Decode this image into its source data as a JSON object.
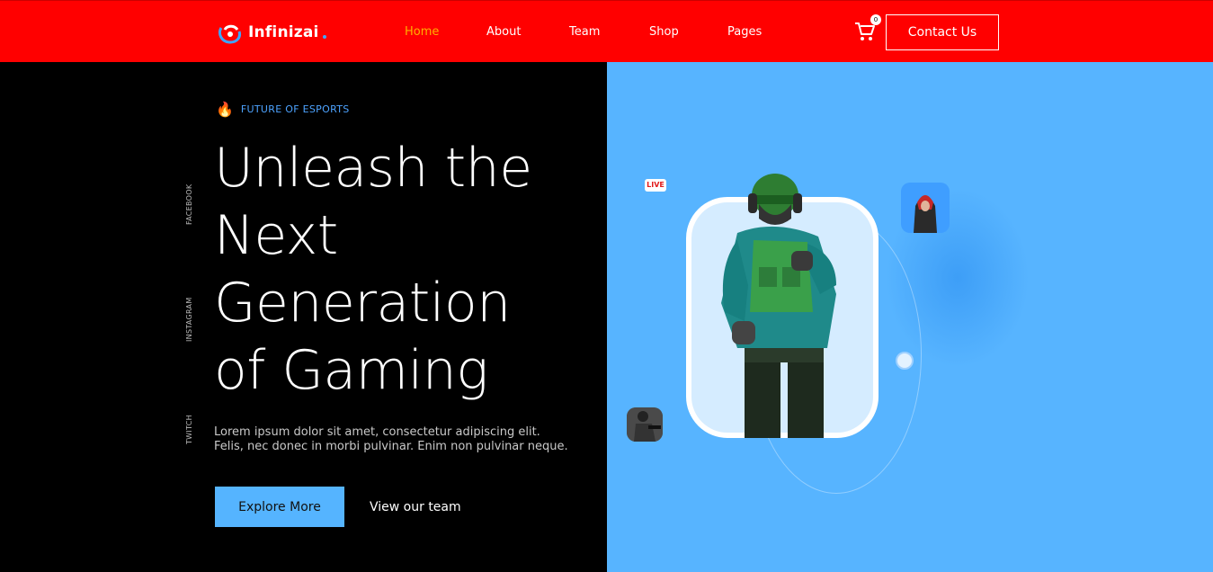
{
  "header": {
    "brand": "Infinizai",
    "nav": [
      {
        "label": "Home",
        "active": true
      },
      {
        "label": "About",
        "active": false
      },
      {
        "label": "Team",
        "active": false
      },
      {
        "label": "Shop",
        "active": false
      },
      {
        "label": "Pages",
        "active": false
      }
    ],
    "cart_count": "0",
    "contact_label": "Contact Us",
    "colors": {
      "bar": "#ff0000",
      "active_nav": "#ffb000"
    }
  },
  "hero": {
    "tagline": "FUTURE OF ESPORTS",
    "title_lines": [
      "Unleash the",
      "Next",
      "Generation",
      "of Gaming"
    ],
    "description_lines": [
      "Lorem ipsum dolor sit amet, consectetur adipiscing elit.",
      "Felis, nec donec in morbi pulvinar. Enim non pulvinar neque."
    ],
    "explore_label": "Explore More",
    "team_link_label": "View our team",
    "social": [
      "FACEBOOK",
      "INSTAGRAM",
      "TWITCH"
    ],
    "live_badge": "LIVE",
    "icons": [
      "fire-icon",
      "cart-icon",
      "logo-icon"
    ],
    "colors": {
      "left_bg": "#000000",
      "right_bg": "#57b4ff",
      "accent": "#4da3ff",
      "button": "#55b4ff"
    }
  }
}
